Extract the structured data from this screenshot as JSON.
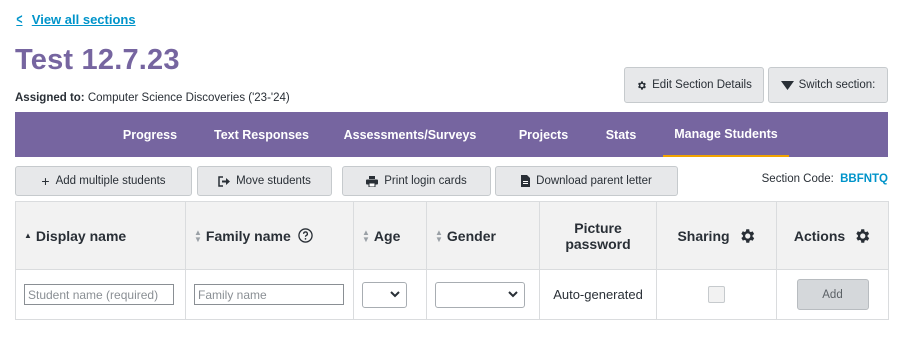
{
  "back_link": {
    "label": "View all sections"
  },
  "section": {
    "title": "Test 12.7.23",
    "assigned_label": "Assigned to:",
    "assigned_value": "Computer Science Discoveries ('23-'24)"
  },
  "header_buttons": {
    "edit": "Edit Section Details",
    "switch": "Switch section:"
  },
  "tabs": [
    {
      "label": "Progress",
      "active": false
    },
    {
      "label": "Text Responses",
      "active": false
    },
    {
      "label": "Assessments/Surveys",
      "active": false
    },
    {
      "label": "Projects",
      "active": false
    },
    {
      "label": "Stats",
      "active": false
    },
    {
      "label": "Manage Students",
      "active": true
    }
  ],
  "actions": {
    "add_multiple": "Add multiple students",
    "move": "Move students",
    "print": "Print login cards",
    "download": "Download parent letter"
  },
  "section_code": {
    "label": "Section Code:",
    "value": "BBFNTQ"
  },
  "table": {
    "columns": {
      "display_name": "Display name",
      "family_name": "Family name",
      "age": "Age",
      "gender": "Gender",
      "picture_password": "Picture password",
      "sharing": "Sharing",
      "actions": "Actions"
    },
    "new_row": {
      "display_placeholder": "Student name (required)",
      "family_placeholder": "Family name",
      "password_value": "Auto-generated",
      "add_label": "Add"
    }
  },
  "colors": {
    "brand_purple": "#7665a0",
    "link_blue": "#0094ca",
    "active_underline": "#f1a300"
  }
}
